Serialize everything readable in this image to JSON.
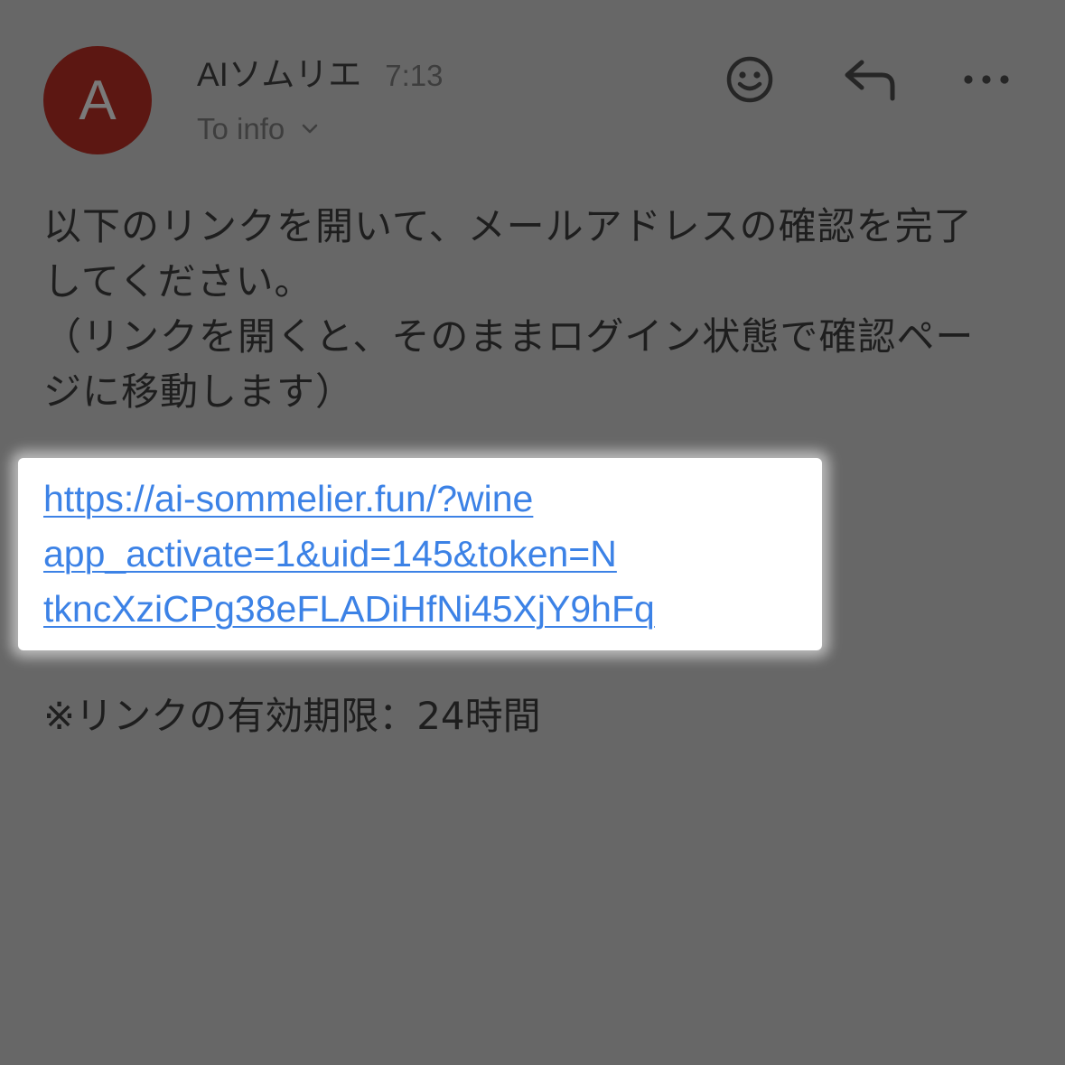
{
  "header": {
    "avatar_letter": "A",
    "sender_name": "AIソムリエ",
    "time": "7:13",
    "recipient": "To info",
    "icons": {
      "emoji": "smiley-icon",
      "reply": "reply-icon",
      "more": "more-horizontal-icon",
      "recipient_expand": "chevron-down-icon"
    }
  },
  "colors": {
    "background": "#676767",
    "avatar": "#5c1712",
    "link": "#3c82e6",
    "highlight": "#ffffff"
  },
  "message": {
    "lines": [
      "以下のリンクを開いて、メールアドレスの確認を完了",
      "してください。",
      "（リンクを開くと、そのままログイン状態で確認ペー",
      "ジに移動します）"
    ],
    "link_lines": [
      "https://ai-sommelier.fun/?wine",
      "app_activate=1&uid=145&token=N",
      "tkncXziCPg38eFLADiHfNi45XjY9hFq"
    ],
    "note": "※リンクの有効期限：24時間"
  }
}
